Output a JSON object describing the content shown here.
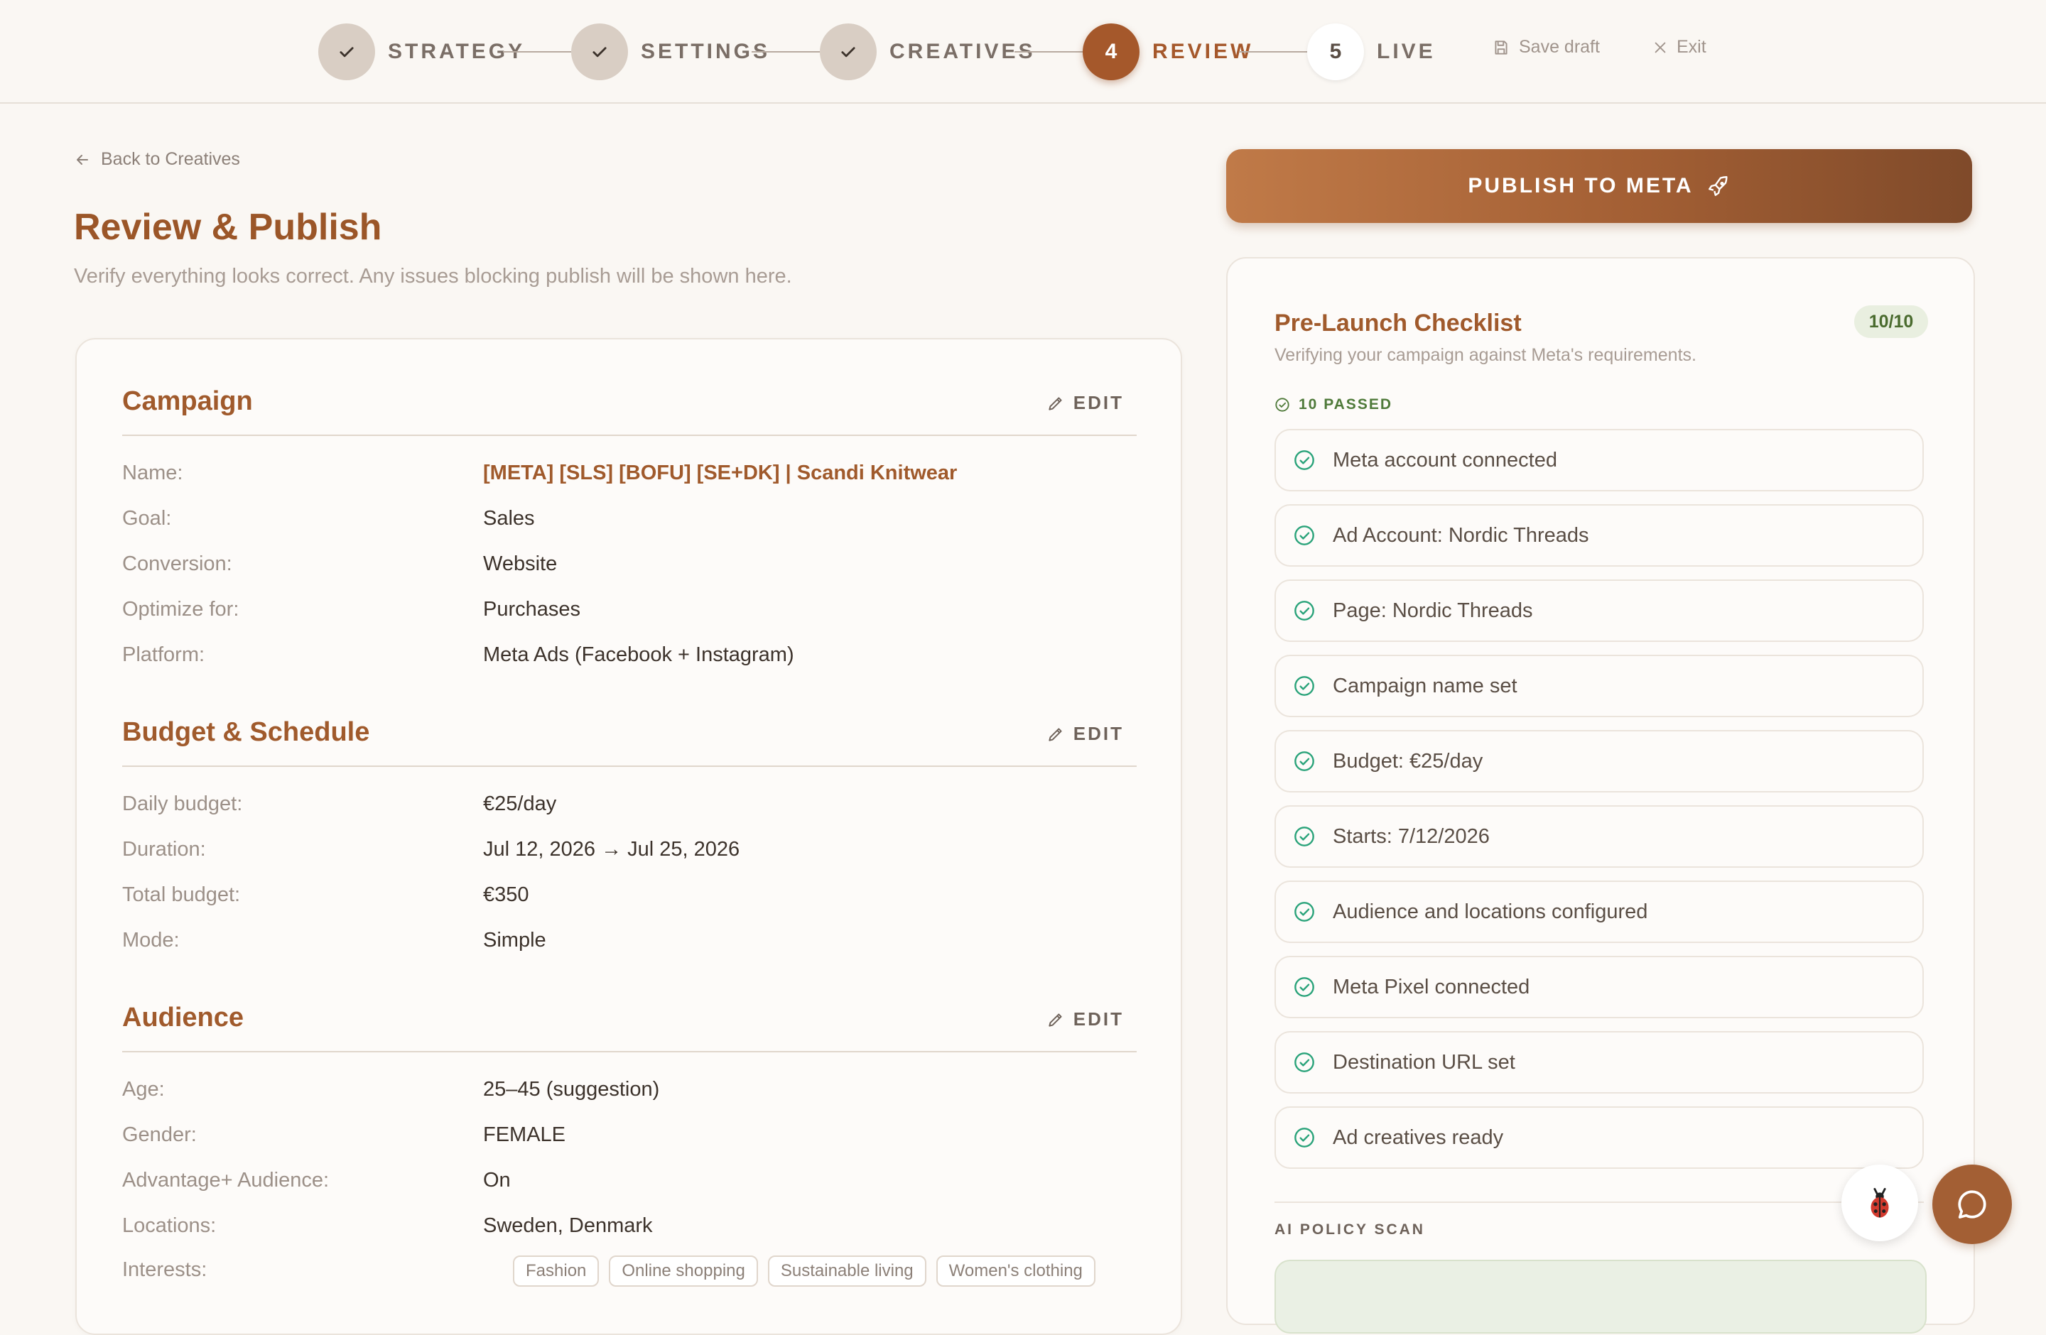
{
  "stepper": {
    "steps": [
      {
        "label": "STRATEGY",
        "status": "done"
      },
      {
        "label": "SETTINGS",
        "status": "done"
      },
      {
        "label": "CREATIVES",
        "status": "done"
      },
      {
        "label": "REVIEW",
        "number": "4",
        "status": "active"
      },
      {
        "label": "LIVE",
        "number": "5",
        "status": "todo"
      }
    ],
    "save_draft": "Save draft",
    "exit": "Exit"
  },
  "page": {
    "back_link": "Back to Creatives",
    "title": "Review & Publish",
    "subtitle": "Verify everything looks correct. Any issues blocking publish will be shown here."
  },
  "campaign": {
    "title": "Campaign",
    "edit": "EDIT",
    "rows": [
      {
        "label": "Name:",
        "value": "[META] [SLS] [BOFU] [SE+DK] | Scandi Knitwear"
      },
      {
        "label": "Goal:",
        "value": "Sales"
      },
      {
        "label": "Conversion:",
        "value": "Website"
      },
      {
        "label": "Optimize for:",
        "value": "Purchases"
      },
      {
        "label": "Platform:",
        "value": "Meta Ads (Facebook + Instagram)"
      }
    ]
  },
  "budget": {
    "title": "Budget & Schedule",
    "edit": "EDIT",
    "rows": [
      {
        "label": "Daily budget:",
        "value": "€25/day"
      },
      {
        "label": "Duration:",
        "value": "Jul 12, 2026 → Jul 25, 2026"
      },
      {
        "label": "Total budget:",
        "value": "€350"
      },
      {
        "label": "Mode:",
        "value": "Simple"
      }
    ]
  },
  "audience": {
    "title": "Audience",
    "edit": "EDIT",
    "rows": [
      {
        "label": "Age:",
        "value": "25–45 (suggestion)"
      },
      {
        "label": "Gender:",
        "value": "FEMALE"
      },
      {
        "label": "Advantage+ Audience:",
        "value": "On"
      },
      {
        "label": "Locations:",
        "value": "Sweden, Denmark"
      },
      {
        "label": "Interests:",
        "value": ""
      }
    ],
    "interests": [
      "Fashion",
      "Online shopping",
      "Sustainable living",
      "Women's clothing"
    ]
  },
  "publish": {
    "label": "PUBLISH TO META"
  },
  "checklist": {
    "title": "Pre-Launch Checklist",
    "badge": "10/10",
    "subtitle": "Verifying your campaign against Meta's requirements.",
    "passed_label": "10 PASSED",
    "items": [
      "Meta account connected",
      "Ad Account: Nordic Threads",
      "Page: Nordic Threads",
      "Campaign name set",
      "Budget: €25/day",
      "Starts: 7/12/2026",
      "Audience and locations configured",
      "Meta Pixel connected",
      "Destination URL set",
      "Ad creatives ready"
    ],
    "ai_scan_label": "AI POLICY SCAN"
  },
  "colors": {
    "accent": "#a5582b",
    "check_green": "#2aa37a",
    "background": "#faf7f3"
  }
}
